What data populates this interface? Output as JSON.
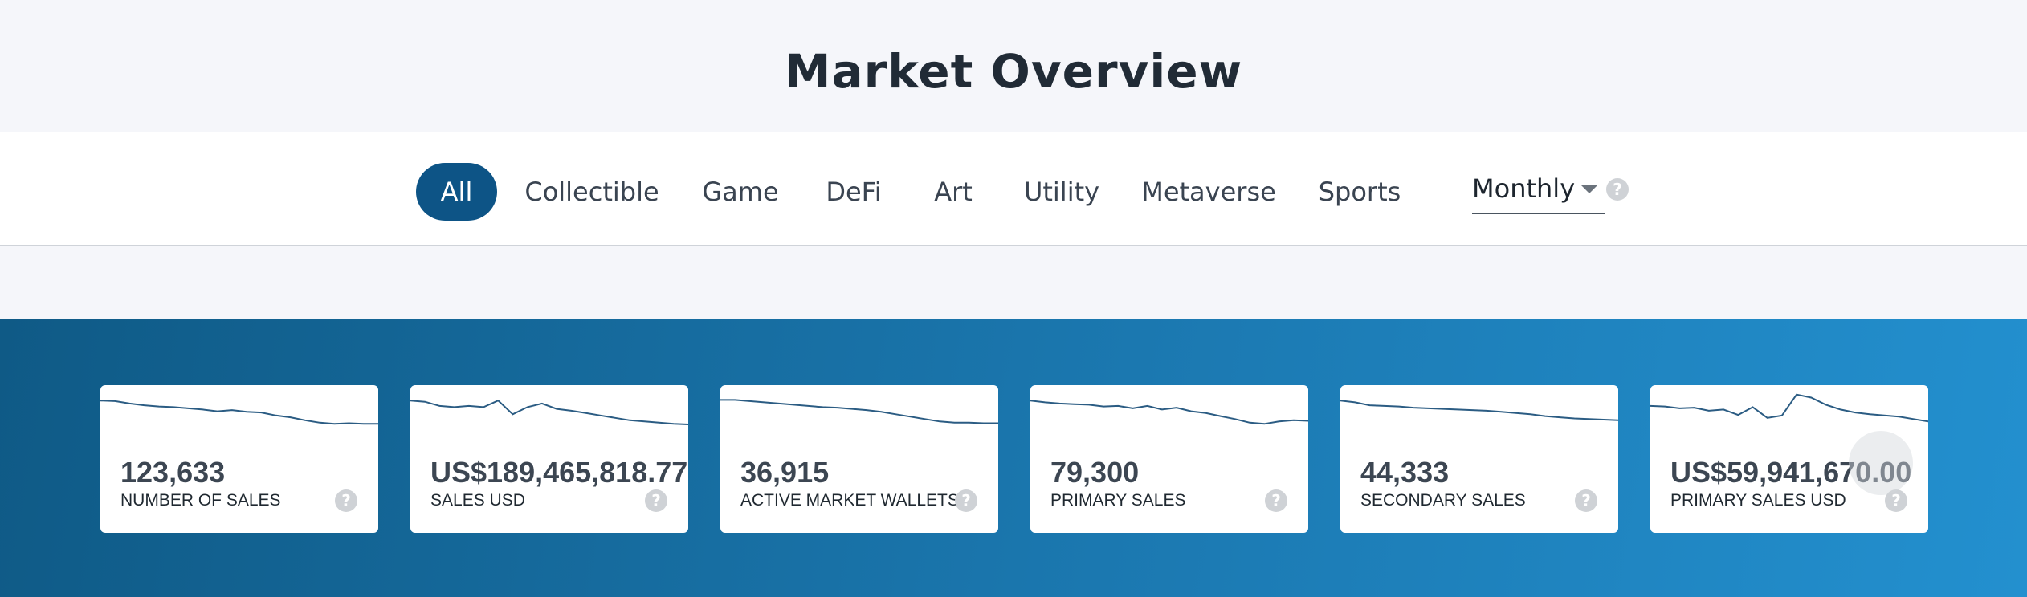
{
  "page": {
    "title": "Market Overview"
  },
  "tabs": [
    {
      "label": "All",
      "active": true
    },
    {
      "label": "Collectible",
      "active": false
    },
    {
      "label": "Game",
      "active": false
    },
    {
      "label": "DeFi",
      "active": false
    },
    {
      "label": "Art",
      "active": false
    },
    {
      "label": "Utility",
      "active": false
    },
    {
      "label": "Metaverse",
      "active": false
    },
    {
      "label": "Sports",
      "active": false
    }
  ],
  "period": {
    "selected": "Monthly"
  },
  "help_icon": {
    "glyph": "?"
  },
  "colors": {
    "accent": "#0d5486",
    "hero_gradient_start": "#0f5a86",
    "hero_gradient_end": "#2390cf",
    "sparkline": "#2b5c83"
  },
  "metrics": [
    {
      "value": "123,633",
      "label": "NUMBER OF SALES",
      "trend": [
        95,
        94,
        90,
        87,
        85,
        84,
        82,
        80,
        77,
        79,
        76,
        75,
        70,
        67,
        62,
        58,
        56,
        57,
        56,
        56
      ]
    },
    {
      "value": "US$189,465,818.77",
      "label": "SALES USD",
      "trend": [
        95,
        93,
        86,
        84,
        86,
        84,
        95,
        72,
        84,
        90,
        81,
        78,
        74,
        70,
        66,
        62,
        60,
        58,
        56,
        55
      ]
    },
    {
      "value": "36,915",
      "label": "ACTIVE MARKET WALLETS",
      "trend": [
        96,
        96,
        94,
        92,
        90,
        88,
        86,
        84,
        83,
        81,
        79,
        76,
        72,
        68,
        64,
        60,
        58,
        58,
        57,
        57
      ]
    },
    {
      "value": "79,300",
      "label": "PRIMARY SALES",
      "trend": [
        95,
        92,
        90,
        89,
        88,
        85,
        86,
        82,
        86,
        80,
        83,
        77,
        74,
        69,
        64,
        58,
        56,
        60,
        62,
        61
      ]
    },
    {
      "value": "44,333",
      "label": "SECONDARY SALES",
      "trend": [
        95,
        92,
        87,
        86,
        85,
        83,
        82,
        81,
        80,
        79,
        78,
        76,
        74,
        72,
        69,
        67,
        65,
        64,
        63,
        62
      ]
    },
    {
      "value": "US$59,941,670.00",
      "label": "PRIMARY SALES USD",
      "trend": [
        86,
        85,
        82,
        83,
        78,
        80,
        71,
        84,
        66,
        70,
        105,
        100,
        88,
        80,
        75,
        72,
        70,
        68,
        64,
        60
      ]
    }
  ]
}
